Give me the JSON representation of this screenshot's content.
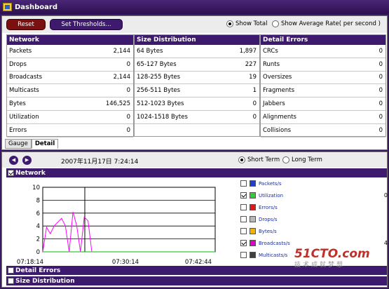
{
  "window": {
    "title": "Dashboard"
  },
  "toolbar": {
    "reset_label": "Reset",
    "thresholds_label": "Set Thresholds...",
    "show_total_label": "Show Total",
    "show_average_label": "Show Average Rate( per second )",
    "selected": "Show Total"
  },
  "network": {
    "header": "Network",
    "rows": [
      {
        "label": "Packets",
        "value": "2,144"
      },
      {
        "label": "Drops",
        "value": "0"
      },
      {
        "label": "Broadcasts",
        "value": "2,144"
      },
      {
        "label": "Multicasts",
        "value": "0"
      },
      {
        "label": "Bytes",
        "value": "146,525"
      },
      {
        "label": "Utilization",
        "value": "0"
      },
      {
        "label": "Errors",
        "value": "0"
      }
    ]
  },
  "size_distribution": {
    "header": "Size Distribution",
    "rows": [
      {
        "label": "64 Bytes",
        "value": "1,897"
      },
      {
        "label": "65-127 Bytes",
        "value": "227"
      },
      {
        "label": "128-255 Bytes",
        "value": "19"
      },
      {
        "label": "256-511 Bytes",
        "value": "1"
      },
      {
        "label": "512-1023 Bytes",
        "value": "0"
      },
      {
        "label": "1024-1518 Bytes",
        "value": "0"
      }
    ]
  },
  "detail_errors": {
    "header": "Detail Errors",
    "rows": [
      {
        "label": "CRCs",
        "value": "0"
      },
      {
        "label": "Runts",
        "value": "0"
      },
      {
        "label": "Oversizes",
        "value": "0"
      },
      {
        "label": "Fragments",
        "value": "0"
      },
      {
        "label": "Jabbers",
        "value": "0"
      },
      {
        "label": "Alignments",
        "value": "0"
      },
      {
        "label": "Collisions",
        "value": "0"
      }
    ]
  },
  "tabs": [
    {
      "label": "Gauge",
      "active": false
    },
    {
      "label": "Detail",
      "active": true
    }
  ],
  "history": {
    "timestamp": "2007年11月17日  7:24:14",
    "short_term_label": "Short Term",
    "long_term_label": "Long Term",
    "selected": "Short Term"
  },
  "sections": {
    "network": "Network",
    "detail_errors": "Detail Errors",
    "size_distribution": "Size Distribution"
  },
  "chart_data": {
    "type": "line",
    "title": "",
    "xlabel": "",
    "ylabel": "",
    "ylim": [
      0,
      10
    ],
    "yticks": [
      "0",
      "2",
      "4",
      "6",
      "8",
      "10"
    ],
    "x_tick_labels": [
      "07:18:14",
      "07:30:14",
      "07:42:44"
    ],
    "grid": true,
    "series": [
      {
        "name": "Broadcasts/s",
        "color": "#ff00ff",
        "values": [
          0,
          3.8,
          2.8,
          4.0,
          4.6,
          5.2,
          4.0,
          0,
          6.2,
          4.0,
          0,
          5.4,
          4.8,
          0
        ]
      },
      {
        "name": "Utilization",
        "color": "#00c000",
        "values": [
          0,
          0,
          0,
          0,
          0,
          0,
          0,
          0,
          0,
          0,
          0,
          0,
          0,
          0,
          0,
          0,
          0,
          0,
          0,
          0,
          0,
          0,
          0,
          0,
          0,
          0,
          0,
          0,
          0,
          0,
          0,
          0,
          0,
          0,
          0,
          0,
          0,
          0,
          0,
          0,
          0,
          0
        ]
      }
    ]
  },
  "legend": [
    {
      "label": "Packets/s",
      "color": "#1f3fd0",
      "checked": false,
      "value": ""
    },
    {
      "label": "Utilization",
      "color": "#33cc33",
      "checked": true,
      "value": "0"
    },
    {
      "label": "Errors/s",
      "color": "#e01818",
      "checked": false,
      "value": ""
    },
    {
      "label": "Drops/s",
      "color": "#b8b8b8",
      "checked": false,
      "value": ""
    },
    {
      "label": "Bytes/s",
      "color": "#f0b400",
      "checked": false,
      "value": ""
    },
    {
      "label": "Broadcasts/s",
      "color": "#e000c8",
      "checked": true,
      "value": "4"
    },
    {
      "label": "Multicasts/s",
      "color": "#404040",
      "checked": false,
      "value": ""
    }
  ],
  "watermark": {
    "line1": "51CTO.com",
    "line2": "技术成就梦想"
  }
}
